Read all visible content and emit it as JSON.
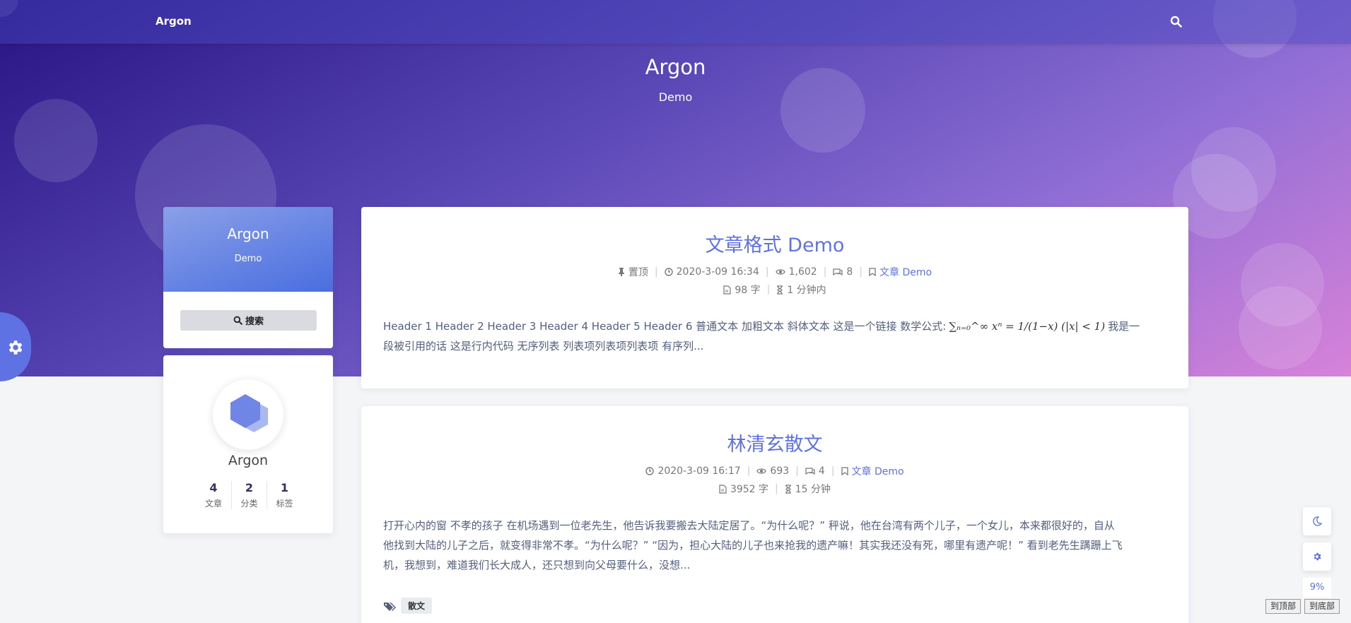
{
  "navbar": {
    "brand": "Argon"
  },
  "hero": {
    "title": "Argon",
    "subtitle": "Demo"
  },
  "left_card": {
    "title": "Argon",
    "subtitle": "Demo",
    "search_label": "搜索"
  },
  "profile": {
    "name": "Argon",
    "stats": [
      {
        "value": "4",
        "label": "文章"
      },
      {
        "value": "2",
        "label": "分类"
      },
      {
        "value": "1",
        "label": "标签"
      }
    ]
  },
  "posts": [
    {
      "title": "文章格式 Demo",
      "meta_line1": {
        "pinned": "置顶",
        "date": "2020-3-09 16:34",
        "views": "1,602",
        "comments": "8",
        "category": "文章 Demo"
      },
      "meta_line2": {
        "words": "98 字",
        "read_time": "1 分钟内"
      },
      "excerpt_part1": "Header 1 Header 2 Header 3 Header 4 Header 5 Header 6 普通文本 加粗文本 斜体文本 这是一个链接 数学公式:",
      "excerpt_math": "∑ₙ₌₀^∞ xⁿ = 1/(1−x)   (|x| < 1)",
      "excerpt_part2": "我是一",
      "excerpt_line2": "段被引用的话 这是行内代码 无序列表 列表项列表项列表项 有序列...",
      "tags": []
    },
    {
      "title": "林清玄散文",
      "meta_line1": {
        "date": "2020-3-09 16:17",
        "views": "693",
        "comments": "4",
        "category": "文章 Demo"
      },
      "meta_line2": {
        "words": "3952 字",
        "read_time": "15 分钟"
      },
      "excerpt_line1": "打开心内的窗 不孝的孩子 在机场遇到一位老先生，他告诉我要搬去大陆定居了。“为什么呢？” 秤说，他在台湾有两个儿子，一个女儿，本来都很好的，自从",
      "excerpt_line2": "他找到大陆的儿子之后，就变得非常不孝。“为什么呢？” “因为，担心大陆的儿子也来抢我的遗产嘛！其实我还没有死，哪里有遗产呢！” 看到老先生蹒跚上飞",
      "excerpt_line3": "机，我想到，难道我们长大成人，还只想到向父母要什么，没想...",
      "tags": [
        "散文"
      ]
    }
  ],
  "floating": {
    "scroll_percent": "9%"
  },
  "footer_buttons": {
    "to_top": "到顶部",
    "to_bottom": "到底部"
  },
  "colors": {
    "accent": "#5e72e4",
    "banner_start": "#281483",
    "banner_end": "#d782d9"
  }
}
